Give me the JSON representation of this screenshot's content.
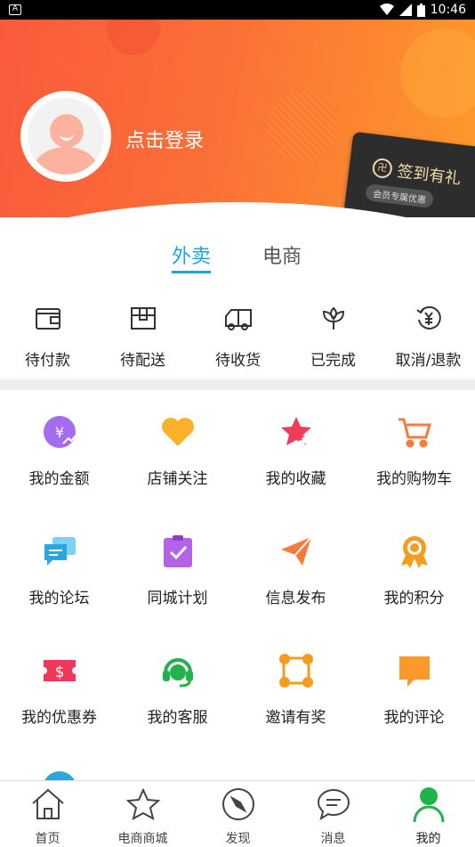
{
  "status_bar": {
    "time": "10:46"
  },
  "header": {
    "login_text": "点击登录",
    "sign_in_card": {
      "title": "签到有礼",
      "subtitle": "会员专属优惠"
    }
  },
  "tabs": [
    {
      "label": "外卖",
      "active": true
    },
    {
      "label": "电商",
      "active": false
    }
  ],
  "orders": [
    {
      "label": "待付款",
      "icon": "wallet-icon"
    },
    {
      "label": "待配送",
      "icon": "box-icon"
    },
    {
      "label": "待收货",
      "icon": "truck-icon"
    },
    {
      "label": "已完成",
      "icon": "flower-icon"
    },
    {
      "label": "取消/退款",
      "icon": "refund-icon"
    }
  ],
  "features": [
    {
      "label": "我的金额",
      "icon": "money-icon",
      "color": "#a46cf0"
    },
    {
      "label": "店铺关注",
      "icon": "heart-icon",
      "color": "#fbb12a"
    },
    {
      "label": "我的收藏",
      "icon": "star-plus-icon",
      "color": "#f13b5a"
    },
    {
      "label": "我的购物车",
      "icon": "cart-icon",
      "color": "#fa7a3c"
    },
    {
      "label": "我的论坛",
      "icon": "chat-icon",
      "color": "#2aa7e0"
    },
    {
      "label": "同城计划",
      "icon": "clipboard-check-icon",
      "color": "#b263e6"
    },
    {
      "label": "信息发布",
      "icon": "paper-plane-icon",
      "color": "#fb7a3a"
    },
    {
      "label": "我的积分",
      "icon": "medal-icon",
      "color": "#f59c1f"
    },
    {
      "label": "我的优惠券",
      "icon": "coupon-icon",
      "color": "#f0385a"
    },
    {
      "label": "我的客服",
      "icon": "headset-icon",
      "color": "#22b24c"
    },
    {
      "label": "邀请有奖",
      "icon": "share-nodes-icon",
      "color": "#f59c1f"
    },
    {
      "label": "我的评论",
      "icon": "comment-icon",
      "color": "#fb9a2a"
    }
  ],
  "bottom_nav": [
    {
      "label": "首页",
      "icon": "home-icon",
      "active": false
    },
    {
      "label": "电商商城",
      "icon": "star-icon",
      "active": false
    },
    {
      "label": "发现",
      "icon": "compass-icon",
      "active": false
    },
    {
      "label": "消息",
      "icon": "message-icon",
      "active": false
    },
    {
      "label": "我的",
      "icon": "person-icon",
      "active": true
    }
  ],
  "colors": {
    "accent": "#1aa7dd",
    "header_start": "#f95a3c",
    "header_end": "#fd9a2c",
    "active_nav": "#22b24c"
  }
}
